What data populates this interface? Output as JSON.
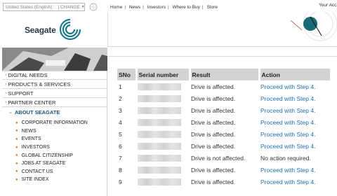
{
  "top": {
    "locale": "United States (English)",
    "change": "CHANGE",
    "nav": [
      "Home",
      "News",
      "Investors",
      "Where to Buy",
      "Store"
    ],
    "account": "Your Acc"
  },
  "brand": {
    "logo": "Seagate",
    "accent": "#1a7a8c",
    "arrow_color": "#e07b1b",
    "link_color": "#1f6fb5"
  },
  "sidebar": {
    "main": [
      "DIGITAL NEEDS",
      "PRODUCTS & SERVICES",
      "SUPPORT",
      "PARTNER CENTER"
    ],
    "section": "ABOUT SEAGATE",
    "sub": [
      "CORPORATE INFORMATION",
      "NEWS",
      "EVENTS",
      "INVESTORS",
      "GLOBAL CITIZENSHIP",
      "JOBS AT SEAGATE",
      "CONTACT US",
      "SITE INDEX"
    ]
  },
  "table": {
    "headers": [
      "SNo",
      "Serial number",
      "Result",
      "Action"
    ],
    "rows": [
      {
        "sno": "1",
        "result": "Drive is affected.",
        "action": "Proceed with Step 4.",
        "link": true
      },
      {
        "sno": "2",
        "result": "Drive is affected.",
        "action": "Proceed with Step 4.",
        "link": true
      },
      {
        "sno": "3",
        "result": "Drive is affected.",
        "action": "Proceed with Step 4.",
        "link": true
      },
      {
        "sno": "4",
        "result": "Drive is affected.",
        "action": "Proceed with Step 4.",
        "link": true
      },
      {
        "sno": "5",
        "result": "Drive is affected.",
        "action": "Proceed with Step 4.",
        "link": true
      },
      {
        "sno": "6",
        "result": "Drive is affected.",
        "action": "Proceed with Step 4.",
        "link": true
      },
      {
        "sno": "7",
        "result": "Drive is not affected.",
        "action": "No action required.",
        "link": false
      },
      {
        "sno": "8",
        "result": "Drive is affected.",
        "action": "Proceed with Step 4.",
        "link": true
      },
      {
        "sno": "9",
        "result": "Drive is affected.",
        "action": "Proceed with Step 4.",
        "link": true
      }
    ]
  }
}
